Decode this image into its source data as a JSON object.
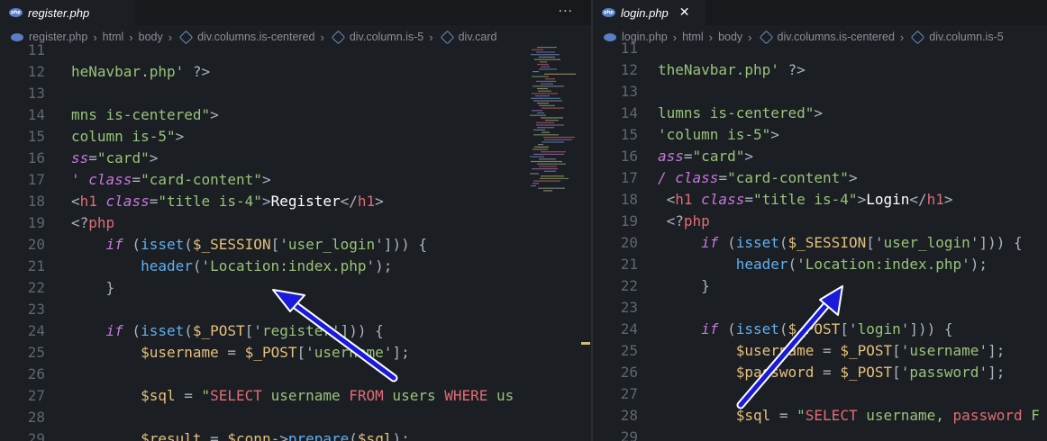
{
  "left": {
    "tab": {
      "label": "register.php",
      "icon": "php-file-icon"
    },
    "more_label": "···",
    "breadcrumb": [
      "register.php",
      "html",
      "body",
      "div.columns.is-centered",
      "div.column.is-5",
      "div.card"
    ],
    "lines": [
      {
        "n": "11",
        "segs": []
      },
      {
        "n": "12",
        "segs": [
          [
            "str",
            "heNavbar.php'"
          ],
          [
            "pun",
            " ?>"
          ]
        ]
      },
      {
        "n": "13",
        "segs": []
      },
      {
        "n": "14",
        "segs": [
          [
            "str",
            "mns is-centered\""
          ],
          [
            "pun",
            ">"
          ]
        ]
      },
      {
        "n": "15",
        "segs": [
          [
            "str",
            "column is-5\""
          ],
          [
            "pun",
            ">"
          ]
        ]
      },
      {
        "n": "16",
        "segs": [
          [
            "attr",
            "ss"
          ],
          [
            "pun",
            "="
          ],
          [
            "str",
            "\"card\""
          ],
          [
            "pun",
            ">"
          ]
        ]
      },
      {
        "n": "17",
        "segs": [
          [
            "attr",
            "' class"
          ],
          [
            "pun",
            "="
          ],
          [
            "str",
            "\"card-content\""
          ],
          [
            "pun",
            ">"
          ]
        ]
      },
      {
        "n": "18",
        "segs": [
          [
            "pun",
            "<"
          ],
          [
            "tag",
            "h1"
          ],
          [
            "attr",
            " class"
          ],
          [
            "pun",
            "="
          ],
          [
            "str",
            "\"title is-4\""
          ],
          [
            "pun",
            ">"
          ],
          [
            "txt",
            "Register"
          ],
          [
            "pun",
            "</"
          ],
          [
            "tag",
            "h1"
          ],
          [
            "pun",
            ">"
          ]
        ]
      },
      {
        "n": "19",
        "segs": [
          [
            "pun",
            "<?"
          ],
          [
            "tag",
            "php"
          ]
        ]
      },
      {
        "n": "20",
        "segs": [
          [
            "plain",
            "    "
          ],
          [
            "kw",
            "if"
          ],
          [
            "pun",
            " ("
          ],
          [
            "fn",
            "isset"
          ],
          [
            "pun",
            "("
          ],
          [
            "var",
            "$_SESSION"
          ],
          [
            "pun",
            "['"
          ],
          [
            "str",
            "user_login"
          ],
          [
            "pun",
            "'])) {"
          ]
        ]
      },
      {
        "n": "21",
        "segs": [
          [
            "plain",
            "        "
          ],
          [
            "fn",
            "header"
          ],
          [
            "pun",
            "('"
          ],
          [
            "str",
            "Location:index.php"
          ],
          [
            "pun",
            "');"
          ]
        ]
      },
      {
        "n": "22",
        "segs": [
          [
            "plain",
            "    "
          ],
          [
            "pun",
            "}"
          ]
        ]
      },
      {
        "n": "23",
        "segs": []
      },
      {
        "n": "24",
        "segs": [
          [
            "plain",
            "    "
          ],
          [
            "kw",
            "if"
          ],
          [
            "pun",
            " ("
          ],
          [
            "fn",
            "isset"
          ],
          [
            "pun",
            "("
          ],
          [
            "var",
            "$_POST"
          ],
          [
            "pun",
            "['"
          ],
          [
            "str",
            "register"
          ],
          [
            "pun",
            "'])) {"
          ]
        ]
      },
      {
        "n": "25",
        "segs": [
          [
            "plain",
            "        "
          ],
          [
            "var",
            "$username"
          ],
          [
            "pun",
            " = "
          ],
          [
            "var",
            "$_POST"
          ],
          [
            "pun",
            "['"
          ],
          [
            "str",
            "username"
          ],
          [
            "pun",
            "'];"
          ]
        ]
      },
      {
        "n": "26",
        "segs": []
      },
      {
        "n": "27",
        "segs": [
          [
            "plain",
            "        "
          ],
          [
            "var",
            "$sql"
          ],
          [
            "pun",
            " = "
          ],
          [
            "str",
            "\""
          ],
          [
            "sqlk",
            "SELECT"
          ],
          [
            "str",
            " username "
          ],
          [
            "sqlk",
            "FROM"
          ],
          [
            "str",
            " users "
          ],
          [
            "sqlk",
            "WHERE"
          ],
          [
            "str",
            " us"
          ]
        ]
      },
      {
        "n": "28",
        "segs": []
      },
      {
        "n": "29",
        "segs": [
          [
            "plain",
            "        "
          ],
          [
            "var",
            "$result"
          ],
          [
            "pun",
            " = "
          ],
          [
            "var",
            "$conn"
          ],
          [
            "pun",
            "->"
          ],
          [
            "fn",
            "prepare"
          ],
          [
            "pun",
            "("
          ],
          [
            "var",
            "$sql"
          ],
          [
            "pun",
            ");"
          ]
        ]
      }
    ]
  },
  "right": {
    "tab": {
      "label": "login.php",
      "icon": "php-file-icon",
      "close": "✕"
    },
    "breadcrumb": [
      "login.php",
      "html",
      "body",
      "div.columns.is-centered",
      "div.column.is-5"
    ],
    "lines": [
      {
        "n": "11",
        "segs": []
      },
      {
        "n": "12",
        "segs": [
          [
            "str",
            "theNavbar.php'"
          ],
          [
            "pun",
            " ?>"
          ]
        ]
      },
      {
        "n": "13",
        "segs": []
      },
      {
        "n": "14",
        "segs": [
          [
            "str",
            "lumns is-centered\""
          ],
          [
            "pun",
            ">"
          ]
        ]
      },
      {
        "n": "15",
        "segs": [
          [
            "str",
            "'column is-5\""
          ],
          [
            "pun",
            ">"
          ]
        ]
      },
      {
        "n": "16",
        "segs": [
          [
            "attr",
            "ass"
          ],
          [
            "pun",
            "="
          ],
          [
            "str",
            "\"card\""
          ],
          [
            "pun",
            ">"
          ]
        ]
      },
      {
        "n": "17",
        "segs": [
          [
            "attr",
            "/ class"
          ],
          [
            "pun",
            "="
          ],
          [
            "str",
            "\"card-content\""
          ],
          [
            "pun",
            ">"
          ]
        ]
      },
      {
        "n": "18",
        "segs": [
          [
            "pun",
            " <"
          ],
          [
            "tag",
            "h1"
          ],
          [
            "attr",
            " class"
          ],
          [
            "pun",
            "="
          ],
          [
            "str",
            "\"title is-4\""
          ],
          [
            "pun",
            ">"
          ],
          [
            "txt",
            "Login"
          ],
          [
            "pun",
            "</"
          ],
          [
            "tag",
            "h1"
          ],
          [
            "pun",
            ">"
          ]
        ]
      },
      {
        "n": "19",
        "segs": [
          [
            "pun",
            " <?"
          ],
          [
            "tag",
            "php"
          ]
        ]
      },
      {
        "n": "20",
        "segs": [
          [
            "plain",
            "     "
          ],
          [
            "kw",
            "if"
          ],
          [
            "pun",
            " ("
          ],
          [
            "fn",
            "isset"
          ],
          [
            "pun",
            "("
          ],
          [
            "var",
            "$_SESSION"
          ],
          [
            "pun",
            "['"
          ],
          [
            "str",
            "user_login"
          ],
          [
            "pun",
            "'])) {"
          ]
        ]
      },
      {
        "n": "21",
        "segs": [
          [
            "plain",
            "         "
          ],
          [
            "fn",
            "header"
          ],
          [
            "pun",
            "('"
          ],
          [
            "str",
            "Location:index.php"
          ],
          [
            "pun",
            "');"
          ]
        ]
      },
      {
        "n": "22",
        "segs": [
          [
            "plain",
            "     "
          ],
          [
            "pun",
            "}"
          ]
        ]
      },
      {
        "n": "23",
        "segs": []
      },
      {
        "n": "24",
        "segs": [
          [
            "plain",
            "     "
          ],
          [
            "kw",
            "if"
          ],
          [
            "pun",
            " ("
          ],
          [
            "fn",
            "isset"
          ],
          [
            "pun",
            "("
          ],
          [
            "var",
            "$_POST"
          ],
          [
            "pun",
            "['"
          ],
          [
            "str",
            "login"
          ],
          [
            "pun",
            "'])) {"
          ]
        ]
      },
      {
        "n": "25",
        "segs": [
          [
            "plain",
            "         "
          ],
          [
            "var",
            "$username"
          ],
          [
            "pun",
            " = "
          ],
          [
            "var",
            "$_POST"
          ],
          [
            "pun",
            "['"
          ],
          [
            "str",
            "username"
          ],
          [
            "pun",
            "'];"
          ]
        ]
      },
      {
        "n": "26",
        "segs": [
          [
            "plain",
            "         "
          ],
          [
            "var",
            "$password"
          ],
          [
            "pun",
            " = "
          ],
          [
            "var",
            "$_POST"
          ],
          [
            "pun",
            "['"
          ],
          [
            "str",
            "password"
          ],
          [
            "pun",
            "'];"
          ]
        ]
      },
      {
        "n": "27",
        "segs": []
      },
      {
        "n": "28",
        "segs": [
          [
            "plain",
            "         "
          ],
          [
            "var",
            "$sql"
          ],
          [
            "pun",
            " = "
          ],
          [
            "str",
            "\""
          ],
          [
            "sqlk",
            "SELECT"
          ],
          [
            "str",
            " username, "
          ],
          [
            "sqlk",
            "password"
          ],
          [
            "str",
            " F"
          ]
        ]
      },
      {
        "n": "29",
        "segs": []
      }
    ]
  },
  "colors": {
    "background": "#1b1e23",
    "arrow": "#1a1adb",
    "arrow_outline": "#ffffff",
    "tab_bar": "#18191c"
  }
}
